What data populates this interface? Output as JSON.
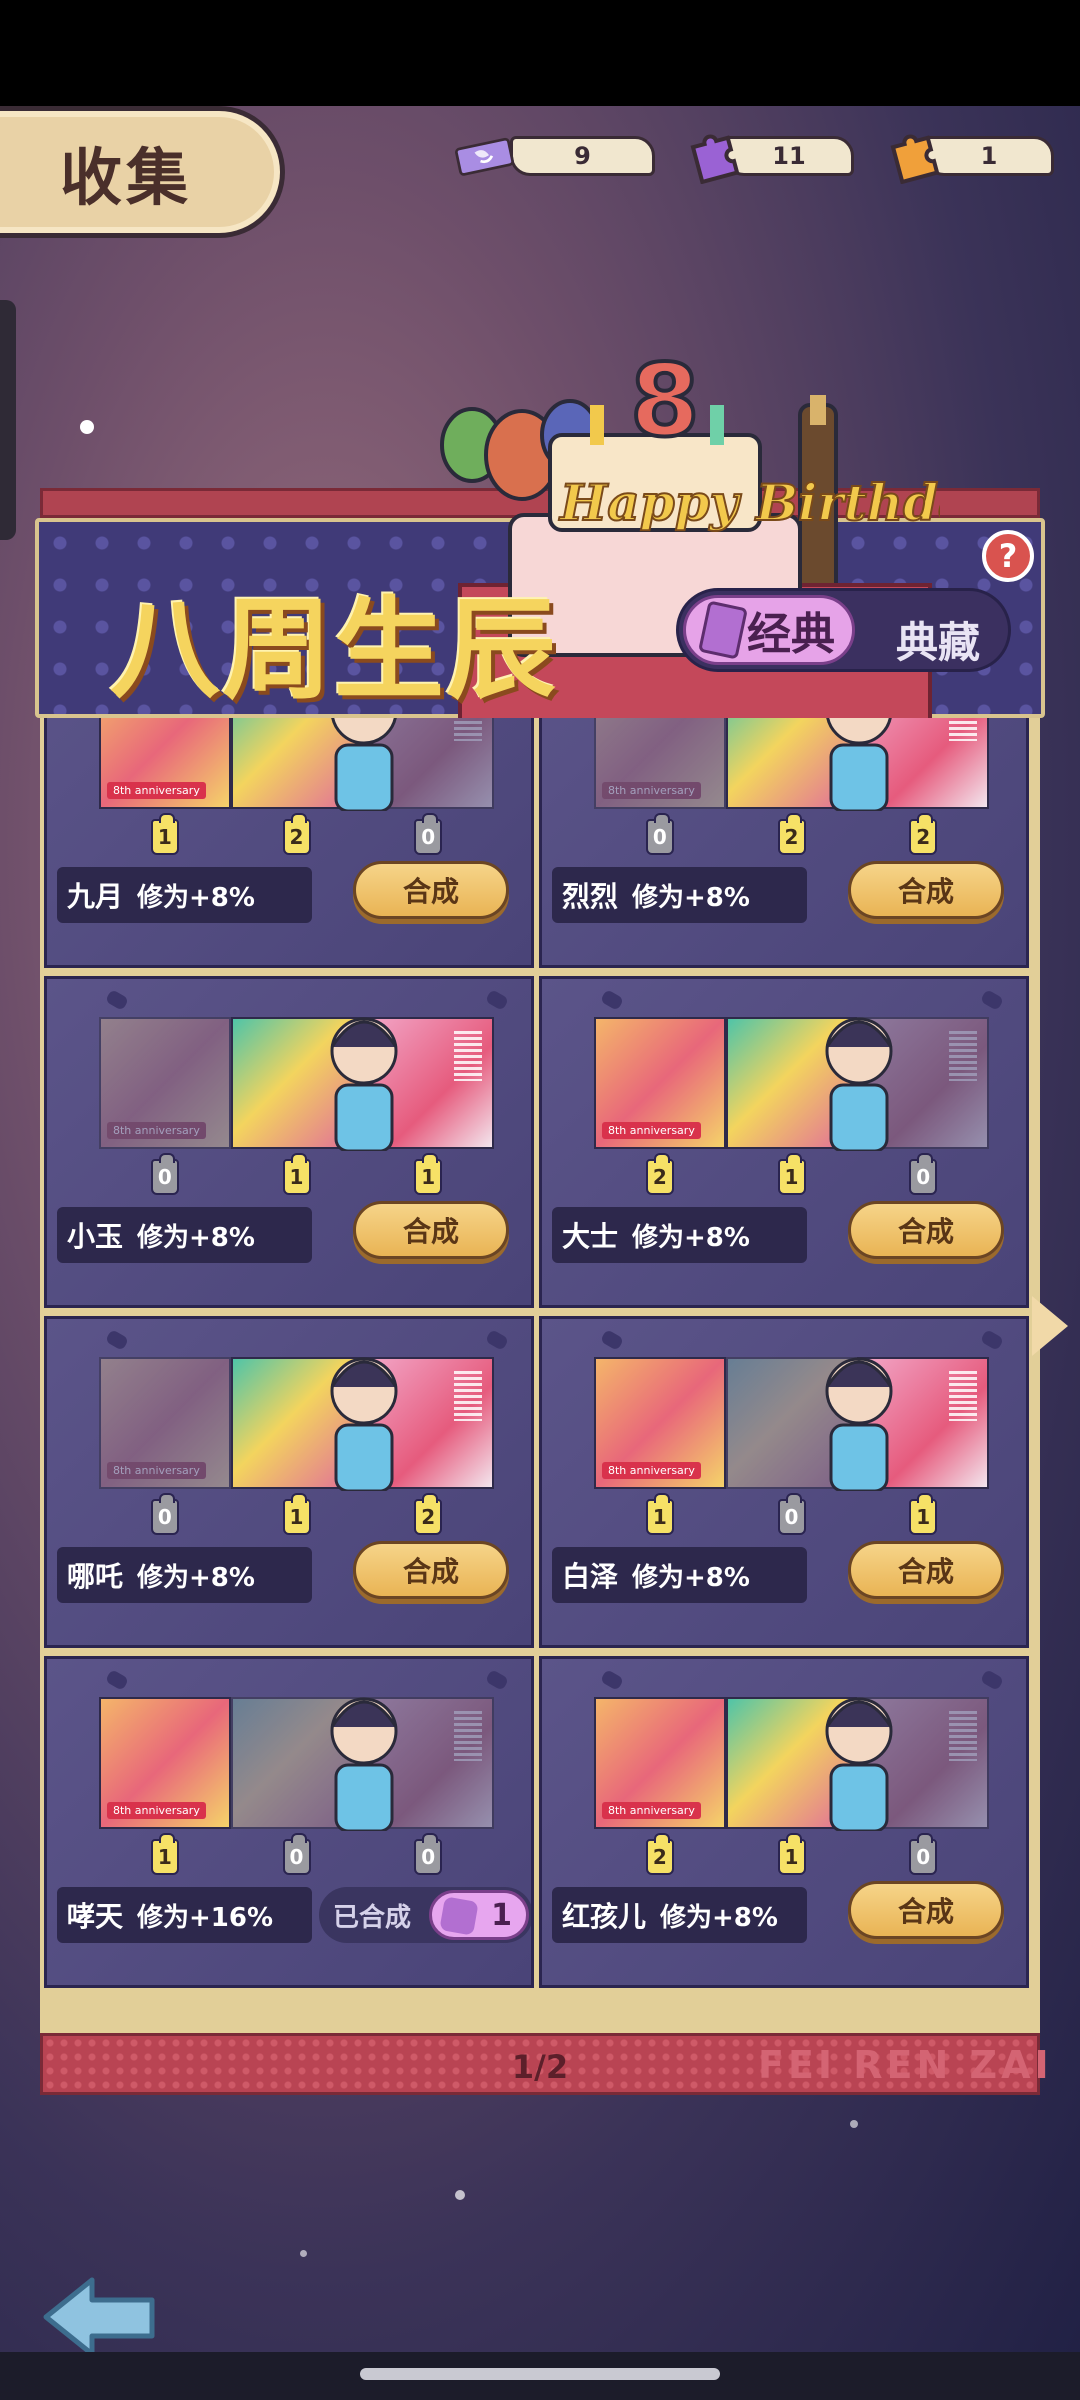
{
  "header": {
    "title": "收集"
  },
  "currencies": [
    {
      "icon": "ticket-icon",
      "value": "9",
      "color": "#a98de3"
    },
    {
      "icon": "purple-puzzle-icon",
      "value": "11",
      "color": "#9a62d4"
    },
    {
      "icon": "orange-puzzle-icon",
      "value": "1",
      "color": "#f0a03a"
    }
  ],
  "banner": {
    "title": "八周生辰",
    "cake_text": "Happy Birthday",
    "cake_number": "8",
    "tabs": {
      "active": "经典",
      "inactive": "典藏"
    },
    "help": "?"
  },
  "cards": [
    {
      "name": "九月",
      "bonus": "修为+8%",
      "counts": [
        "1",
        "2",
        "0"
      ],
      "action": "合成",
      "anniv": "8th anniversary"
    },
    {
      "name": "烈烈",
      "bonus": "修为+8%",
      "counts": [
        "0",
        "2",
        "2"
      ],
      "action": "合成",
      "anniv": "8th anniversary"
    },
    {
      "name": "小玉",
      "bonus": "修为+8%",
      "counts": [
        "0",
        "1",
        "1"
      ],
      "action": "合成",
      "anniv": "8th anniversary"
    },
    {
      "name": "大士",
      "bonus": "修为+8%",
      "counts": [
        "2",
        "1",
        "0"
      ],
      "action": "合成",
      "anniv": "8th anniversary"
    },
    {
      "name": "哪吒",
      "bonus": "修为+8%",
      "counts": [
        "0",
        "1",
        "2"
      ],
      "action": "合成",
      "anniv": "8th anniversary"
    },
    {
      "name": "白泽",
      "bonus": "修为+8%",
      "counts": [
        "1",
        "0",
        "1"
      ],
      "action": "合成",
      "anniv": "8th anniversary"
    },
    {
      "name": "哮天",
      "bonus": "修为+16%",
      "counts": [
        "1",
        "0",
        "0"
      ],
      "done_label": "已合成",
      "done_count": "1",
      "anniv": "8th anniversary"
    },
    {
      "name": "红孩儿",
      "bonus": "修为+8%",
      "counts": [
        "2",
        "1",
        "0"
      ],
      "action": "合成",
      "anniv": "8th anniversary"
    }
  ],
  "footer": {
    "page": "1/2",
    "wordmark": "FEI REN ZAI"
  }
}
